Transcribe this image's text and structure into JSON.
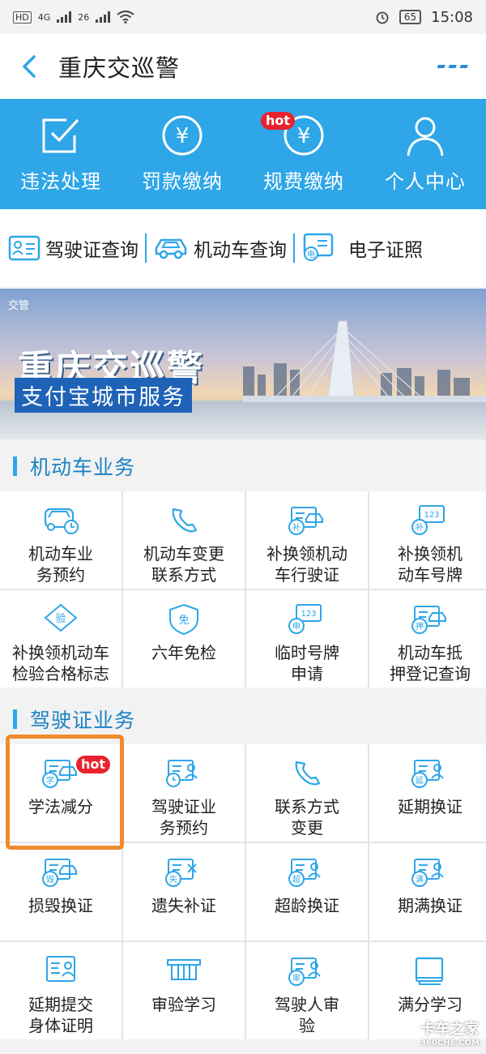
{
  "status_bar": {
    "network": "4G",
    "network2": "26",
    "battery": "65",
    "time": "15:08"
  },
  "nav": {
    "title": "重庆交巡警"
  },
  "top_actions": [
    {
      "label": "违法处理",
      "icon": "check-square-icon"
    },
    {
      "label": "罚款缴纳",
      "icon": "yen-circle-icon"
    },
    {
      "label": "规费缴纳",
      "icon": "yen-circle-icon",
      "badge": "hot"
    },
    {
      "label": "个人中心",
      "icon": "person-icon"
    }
  ],
  "quick_links": [
    {
      "label": "驾驶证查询",
      "icon": "id-card-icon"
    },
    {
      "label": "机动车查询",
      "icon": "car-icon"
    },
    {
      "label": "电子证照",
      "icon": "e-license-icon"
    }
  ],
  "banner": {
    "brand": "交管",
    "title": "重庆交巡警",
    "subtitle": "支付宝城市服务"
  },
  "sections": [
    {
      "title": "机动车业务",
      "items": [
        {
          "label": "机动车业\n务预约",
          "icon": "car-clock-icon"
        },
        {
          "label": "机动车变更\n联系方式",
          "icon": "phone-icon"
        },
        {
          "label": "补换领机动\n车行驶证",
          "icon": "license-replace-icon"
        },
        {
          "label": "补换领机\n动车号牌",
          "icon": "plate-replace-icon"
        },
        {
          "label": "补换领机动车\n检验合格标志",
          "icon": "inspection-tag-icon"
        },
        {
          "label": "六年免检",
          "icon": "shield-exempt-icon"
        },
        {
          "label": "临时号牌\n申请",
          "icon": "temp-plate-icon"
        },
        {
          "label": "机动车抵\n押登记查询",
          "icon": "mortgage-car-icon"
        }
      ]
    },
    {
      "title": "驾驶证业务",
      "items": [
        {
          "label": "学法减分",
          "icon": "study-car-icon",
          "badge": "hot"
        },
        {
          "label": "驾驶证业\n务预约",
          "icon": "license-clock-icon"
        },
        {
          "label": "联系方式\n变更",
          "icon": "phone-icon"
        },
        {
          "label": "延期换证",
          "icon": "extend-license-icon"
        },
        {
          "label": "损毁换证",
          "icon": "damaged-license-icon"
        },
        {
          "label": "遗失补证",
          "icon": "lost-license-icon"
        },
        {
          "label": "超龄换证",
          "icon": "overage-license-icon"
        },
        {
          "label": "期满换证",
          "icon": "expiry-license-icon"
        },
        {
          "label": "延期提交\n身体证明",
          "icon": "health-cert-icon"
        },
        {
          "label": "审验学习",
          "icon": "review-study-icon"
        },
        {
          "label": "驾驶人审\n验",
          "icon": "driver-review-icon"
        },
        {
          "label": "满分学习",
          "icon": "book-icon"
        }
      ]
    }
  ],
  "watermark": {
    "text": "卡车之家",
    "sub": "360CHE.COM"
  },
  "colors": {
    "primary": "#2ea6e8",
    "hot": "#e8232d",
    "highlight": "#f08a2c"
  }
}
